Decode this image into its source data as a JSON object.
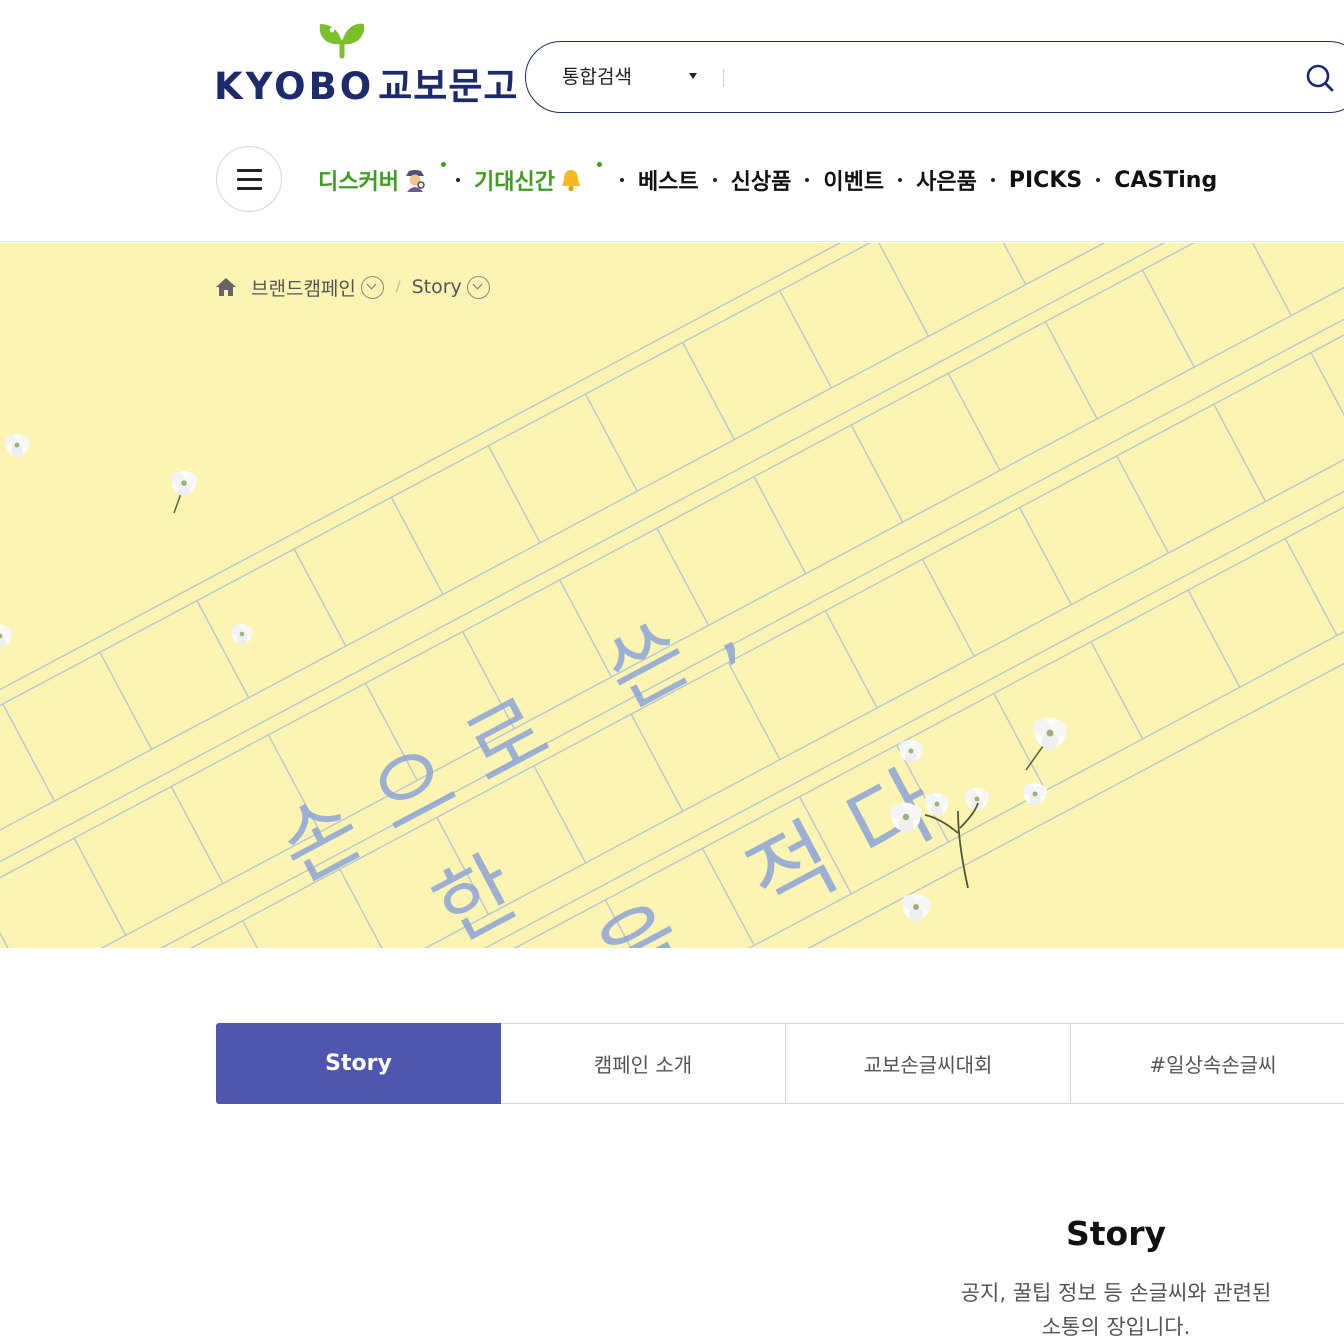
{
  "brand": {
    "latin": "KYOBO",
    "korean": "교보문고"
  },
  "search": {
    "scope_label": "통합검색",
    "placeholder": "",
    "value": ""
  },
  "gnb": [
    {
      "label": "디스커버",
      "emoji": "🕵",
      "green": true,
      "new": true
    },
    {
      "label": "기대신간",
      "emoji": "🔔",
      "green": true,
      "new": true
    },
    {
      "label": "베스트"
    },
    {
      "label": "신상품"
    },
    {
      "label": "이벤트"
    },
    {
      "label": "사은품"
    },
    {
      "label": "PICKS"
    },
    {
      "label": "CASTing"
    }
  ],
  "breadcrumb": {
    "level1": "브랜드캠페인",
    "level2": "Story"
  },
  "hero": {
    "headline_lines": [
      "손으로 쓴,",
      "한",
      "마음을 적다"
    ],
    "colors": {
      "background": "#fbf4b3",
      "grid": "#b8c7cf",
      "lettering": "#8ba5d8"
    }
  },
  "tabs": [
    {
      "label": "Story",
      "active": true
    },
    {
      "label": "캠페인 소개"
    },
    {
      "label": "교보손글씨대회"
    },
    {
      "label": "#일상속손글씨"
    }
  ],
  "story": {
    "title": "Story",
    "description_line1": "공지, 꿀팁 정보 등 손글씨와 관련된",
    "description_line2": "소통의 장입니다."
  },
  "colors": {
    "brand_navy": "#1d2a6b",
    "brand_green": "#3f9e1f",
    "tab_active": "#4f56ad"
  }
}
